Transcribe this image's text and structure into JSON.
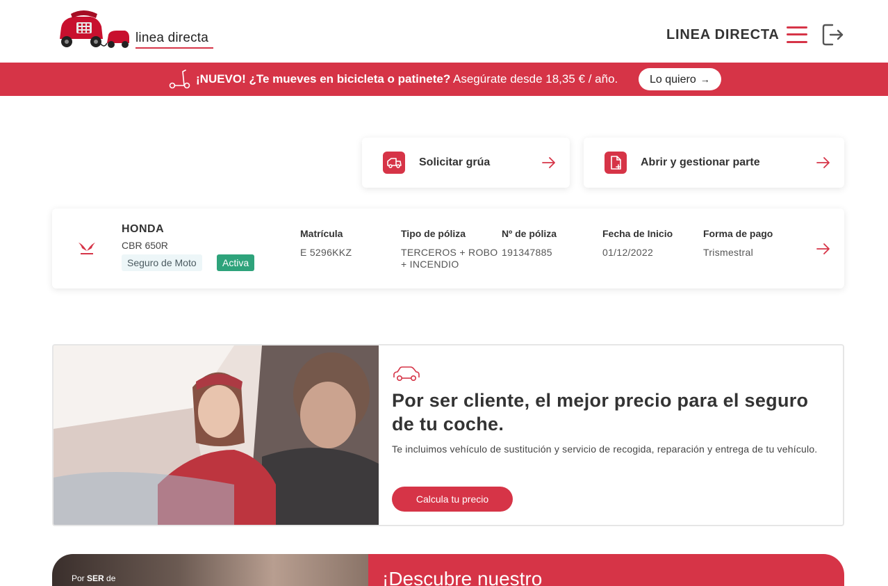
{
  "header": {
    "logo_text": "linea directa",
    "brand": "LINEA DIRECTA"
  },
  "promo_banner": {
    "highlight": "¡NUEVO! ¿Te mueves en bicicleta o patinete?",
    "text": " Asegúrate desde 18,35 € / año.",
    "button_label": "Lo quiero"
  },
  "actions": [
    {
      "label": "Solicitar grúa",
      "icon": "tow-truck-icon"
    },
    {
      "label": "Abrir y gestionar parte",
      "icon": "document-add-icon"
    }
  ],
  "policy": {
    "brand": "HONDA",
    "model": "CBR 650R",
    "insurance_type": "Seguro de Moto",
    "status": "Activa",
    "columns": [
      {
        "header": "Matrícula",
        "value": "E 5296KKZ"
      },
      {
        "header": "Tipo de póliza",
        "value": "TERCEROS + ROBO + INCENDIO"
      },
      {
        "header": "Nº de póliza",
        "value": "191347885"
      },
      {
        "header": "Fecha de Inicio",
        "value": "01/12/2022"
      },
      {
        "header": "Forma de pago",
        "value": "Trismestral"
      }
    ]
  },
  "car_promo": {
    "title": "Por ser cliente, el mejor precio para el seguro de tu coche.",
    "description": "Te incluimos vehículo de sustitución y servicio de recogida, reparación y entrega de tu vehículo.",
    "button_label": "Calcula tu precio"
  },
  "teaser": {
    "small_prefix": "Por ",
    "small_bold": "SER",
    "small_suffix": " de",
    "title": "¡Descubre nuestro"
  },
  "colors": {
    "brand_red": "#d63447",
    "status_green": "#2ea37b"
  }
}
